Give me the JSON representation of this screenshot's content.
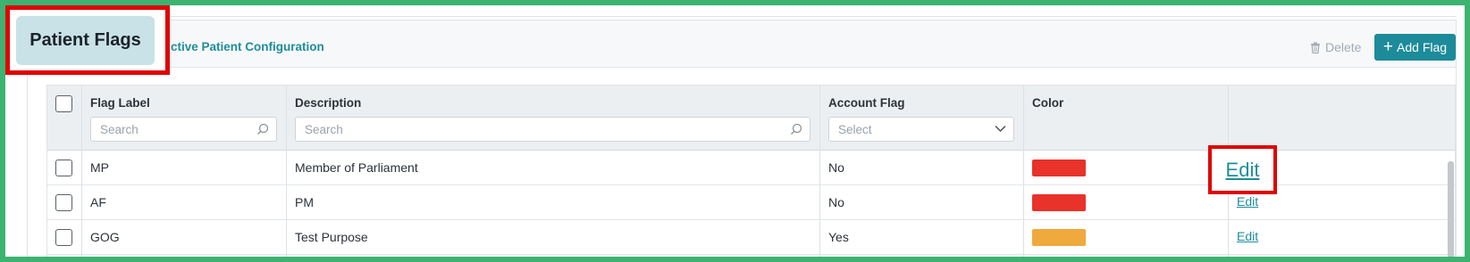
{
  "page": {
    "title": "Patient Flags",
    "breadcrumb": "ctive Patient Configuration"
  },
  "toolbar": {
    "delete_label": "Delete",
    "add_label": "Add Flag",
    "delete_icon": "trash-icon",
    "add_icon": "plus-icon"
  },
  "table": {
    "columns": [
      {
        "label": "Flag Label",
        "filter_placeholder": "Search",
        "filter_type": "search"
      },
      {
        "label": "Description",
        "filter_placeholder": "Search",
        "filter_type": "search"
      },
      {
        "label": "Account Flag",
        "filter_placeholder": "Select",
        "filter_type": "select"
      },
      {
        "label": "Color"
      },
      {
        "label": ""
      }
    ],
    "rows": [
      {
        "label": "MP",
        "description": "Member of Parliament",
        "account_flag": "No",
        "color": "#e8322a",
        "action": "Edit"
      },
      {
        "label": "AF",
        "description": "PM",
        "account_flag": "No",
        "color": "#e8322a",
        "action": "Edit"
      },
      {
        "label": "GOG",
        "description": "Test Purpose",
        "account_flag": "Yes",
        "color": "#f0a93c",
        "action": "Edit"
      }
    ]
  },
  "colors": {
    "accent": "#1d8b9a",
    "highlight": "#e00000",
    "frame": "#3cb371"
  }
}
